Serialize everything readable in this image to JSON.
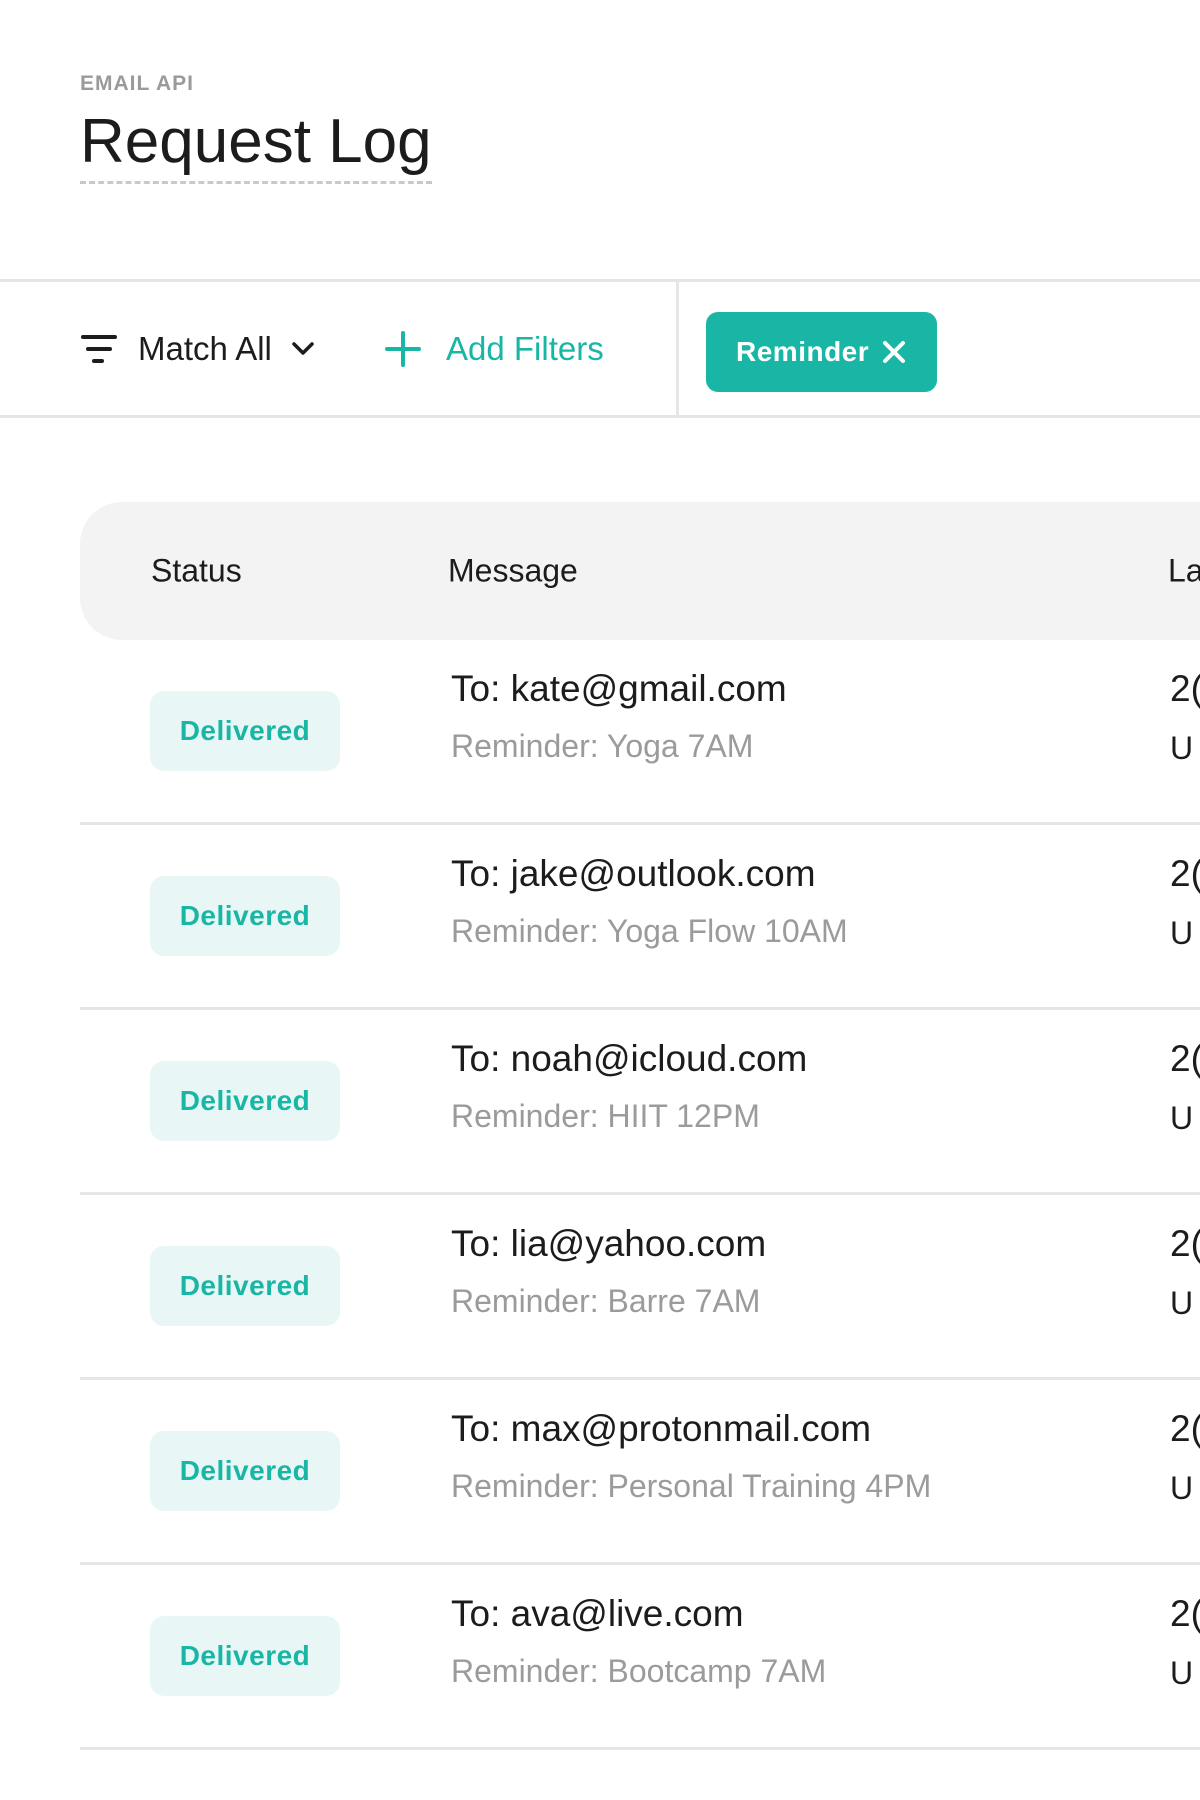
{
  "header": {
    "eyebrow": "EMAIL API",
    "title": "Request Log"
  },
  "filters": {
    "match_label": "Match All",
    "add_label": "Add Filters",
    "active_chip": "Reminder",
    "accent_color": "#19b6a6"
  },
  "table": {
    "columns": [
      "Status",
      "Message",
      "La"
    ],
    "rows": [
      {
        "status": "Delivered",
        "to": "To: kate@gmail.com",
        "subject": "Reminder: Yoga 7AM",
        "date": "2(",
        "tz": "U"
      },
      {
        "status": "Delivered",
        "to": "To: jake@outlook.com",
        "subject": "Reminder: Yoga Flow 10AM",
        "date": "2(",
        "tz": "U"
      },
      {
        "status": "Delivered",
        "to": "To: noah@icloud.com",
        "subject": "Reminder: HIIT 12PM",
        "date": "2(",
        "tz": "U"
      },
      {
        "status": "Delivered",
        "to": " To: lia@yahoo.com",
        "subject": "Reminder: Barre 7AM",
        "date": "2(",
        "tz": "U"
      },
      {
        "status": "Delivered",
        "to": "To: max@protonmail.com",
        "subject": "Reminder: Personal Training 4PM",
        "date": "2(",
        "tz": "U"
      },
      {
        "status": "Delivered",
        "to": "To: ava@live.com",
        "subject": "Reminder: Bootcamp 7AM",
        "date": "2(",
        "tz": "U"
      }
    ]
  }
}
